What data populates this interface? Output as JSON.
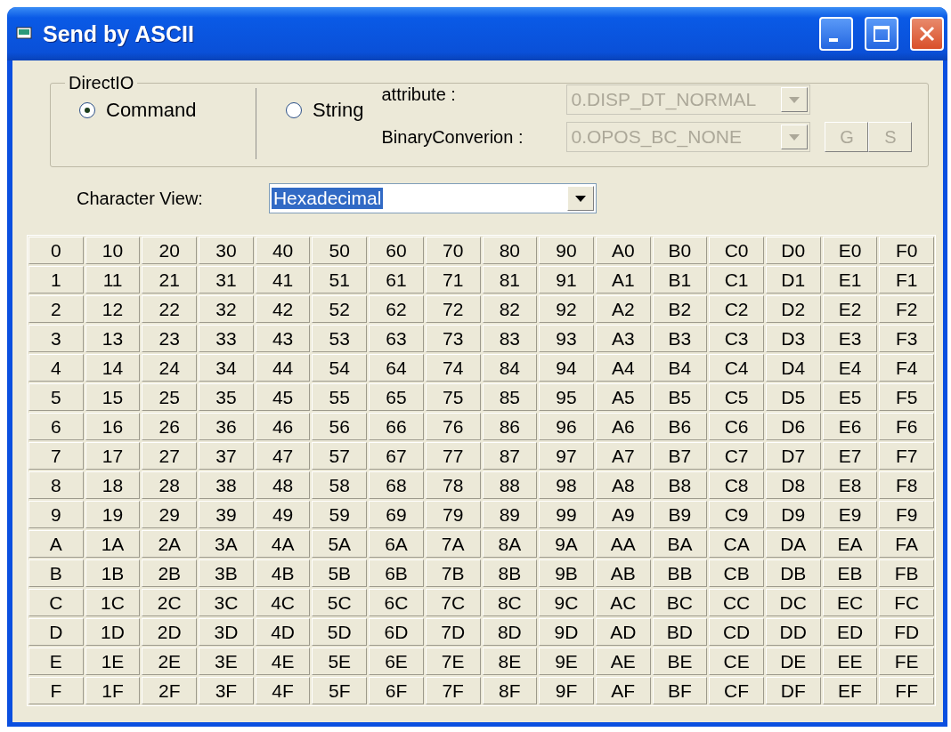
{
  "window": {
    "title": "Send by ASCII"
  },
  "direct_io": {
    "label": "DirectIO",
    "modes": [
      {
        "label": "Command",
        "selected": true
      },
      {
        "label": "String",
        "selected": false
      }
    ],
    "attribute": {
      "label": "attribute :",
      "value": "0.DISP_DT_NORMAL",
      "disabled": true
    },
    "binary_conversion": {
      "label": "BinaryConverion :",
      "value": "0.OPOS_BC_NONE",
      "disabled": true
    },
    "buttons": [
      {
        "label": "G",
        "disabled": true
      },
      {
        "label": "S",
        "disabled": true
      }
    ]
  },
  "character_view": {
    "label": "Character View:",
    "value": "Hexadecimal"
  },
  "grid": {
    "rows": [
      [
        "0",
        "10",
        "20",
        "30",
        "40",
        "50",
        "60",
        "70",
        "80",
        "90",
        "A0",
        "B0",
        "C0",
        "D0",
        "E0",
        "F0"
      ],
      [
        "1",
        "11",
        "21",
        "31",
        "41",
        "51",
        "61",
        "71",
        "81",
        "91",
        "A1",
        "B1",
        "C1",
        "D1",
        "E1",
        "F1"
      ],
      [
        "2",
        "12",
        "22",
        "32",
        "42",
        "52",
        "62",
        "72",
        "82",
        "92",
        "A2",
        "B2",
        "C2",
        "D2",
        "E2",
        "F2"
      ],
      [
        "3",
        "13",
        "23",
        "33",
        "43",
        "53",
        "63",
        "73",
        "83",
        "93",
        "A3",
        "B3",
        "C3",
        "D3",
        "E3",
        "F3"
      ],
      [
        "4",
        "14",
        "24",
        "34",
        "44",
        "54",
        "64",
        "74",
        "84",
        "94",
        "A4",
        "B4",
        "C4",
        "D4",
        "E4",
        "F4"
      ],
      [
        "5",
        "15",
        "25",
        "35",
        "45",
        "55",
        "65",
        "75",
        "85",
        "95",
        "A5",
        "B5",
        "C5",
        "D5",
        "E5",
        "F5"
      ],
      [
        "6",
        "16",
        "26",
        "36",
        "46",
        "56",
        "66",
        "76",
        "86",
        "96",
        "A6",
        "B6",
        "C6",
        "D6",
        "E6",
        "F6"
      ],
      [
        "7",
        "17",
        "27",
        "37",
        "47",
        "57",
        "67",
        "77",
        "87",
        "97",
        "A7",
        "B7",
        "C7",
        "D7",
        "E7",
        "F7"
      ],
      [
        "8",
        "18",
        "28",
        "38",
        "48",
        "58",
        "68",
        "78",
        "88",
        "98",
        "A8",
        "B8",
        "C8",
        "D8",
        "E8",
        "F8"
      ],
      [
        "9",
        "19",
        "29",
        "39",
        "49",
        "59",
        "69",
        "79",
        "89",
        "99",
        "A9",
        "B9",
        "C9",
        "D9",
        "E9",
        "F9"
      ],
      [
        "A",
        "1A",
        "2A",
        "3A",
        "4A",
        "5A",
        "6A",
        "7A",
        "8A",
        "9A",
        "AA",
        "BA",
        "CA",
        "DA",
        "EA",
        "FA"
      ],
      [
        "B",
        "1B",
        "2B",
        "3B",
        "4B",
        "5B",
        "6B",
        "7B",
        "8B",
        "9B",
        "AB",
        "BB",
        "CB",
        "DB",
        "EB",
        "FB"
      ],
      [
        "C",
        "1C",
        "2C",
        "3C",
        "4C",
        "5C",
        "6C",
        "7C",
        "8C",
        "9C",
        "AC",
        "BC",
        "CC",
        "DC",
        "EC",
        "FC"
      ],
      [
        "D",
        "1D",
        "2D",
        "3D",
        "4D",
        "5D",
        "6D",
        "7D",
        "8D",
        "9D",
        "AD",
        "BD",
        "CD",
        "DD",
        "ED",
        "FD"
      ],
      [
        "E",
        "1E",
        "2E",
        "3E",
        "4E",
        "5E",
        "6E",
        "7E",
        "8E",
        "9E",
        "AE",
        "BE",
        "CE",
        "DE",
        "EE",
        "FE"
      ],
      [
        "F",
        "1F",
        "2F",
        "3F",
        "4F",
        "5F",
        "6F",
        "7F",
        "8F",
        "9F",
        "AF",
        "BF",
        "CF",
        "DF",
        "EF",
        "FF"
      ]
    ]
  }
}
